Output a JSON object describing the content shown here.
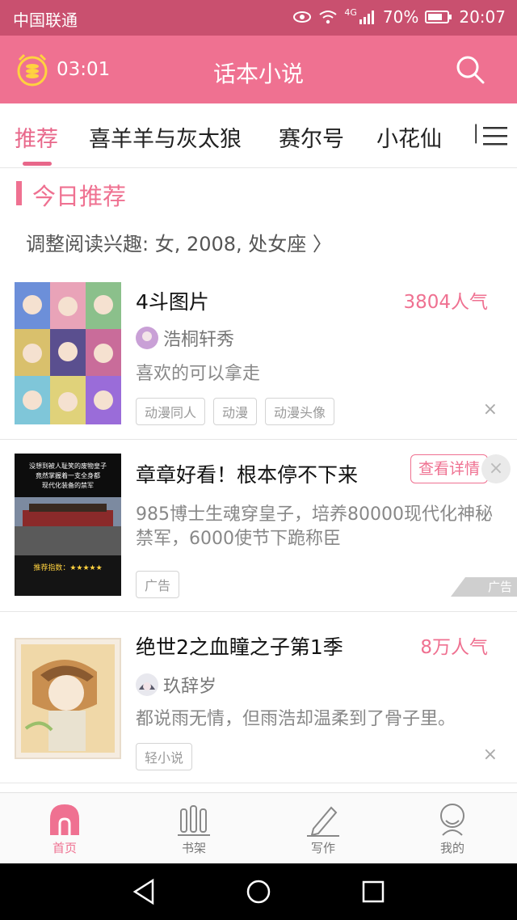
{
  "status": {
    "carrier": "中国联通",
    "network": "4G",
    "battery": "70%",
    "time": "20:07"
  },
  "header": {
    "timer": "03:01",
    "title": "话本小说"
  },
  "tabs": [
    {
      "label": "推荐"
    },
    {
      "label": "喜羊羊与灰太狼"
    },
    {
      "label": "赛尔号"
    },
    {
      "label": "小花仙"
    },
    {
      "label": "["
    }
  ],
  "section": {
    "title": "今日推荐",
    "interest": "调整阅读兴趣: 女, 2008, 处女座 〉"
  },
  "cards": [
    {
      "title": "4斗图片",
      "popularity": "3804人气",
      "author": "浩桐轩秀",
      "desc": "喜欢的可以拿走",
      "tags": [
        "动漫同人",
        "动漫",
        "动漫头像"
      ],
      "close": "×"
    },
    {
      "title": "章章好看！根本停不下来",
      "button": "查看详情",
      "desc": "985博士生魂穿皇子，培养80000现代化神秘禁军，6000使节下跪称臣",
      "tags": [
        "广告"
      ],
      "ad_badge": "广告",
      "close": "×",
      "thumb_text": {
        "line1": "没想到被人耻笑的废物皇子",
        "line2": "竟然掌握着一支全身都",
        "line3": "现代化装备的禁军",
        "rating": "推荐指数：★★★★★"
      }
    },
    {
      "title": "绝世2之血瞳之子第1季",
      "popularity": "8万人气",
      "author": "玖辞岁",
      "desc": "都说雨无情，但雨浩却温柔到了骨子里。",
      "tags": [
        "轻小说"
      ],
      "close": "×"
    }
  ],
  "nav": [
    {
      "label": "首页",
      "active": true
    },
    {
      "label": "书架"
    },
    {
      "label": "写作"
    },
    {
      "label": "我的"
    }
  ],
  "colors": {
    "accent": "#ef7191",
    "statusbar": "#c9506f"
  }
}
